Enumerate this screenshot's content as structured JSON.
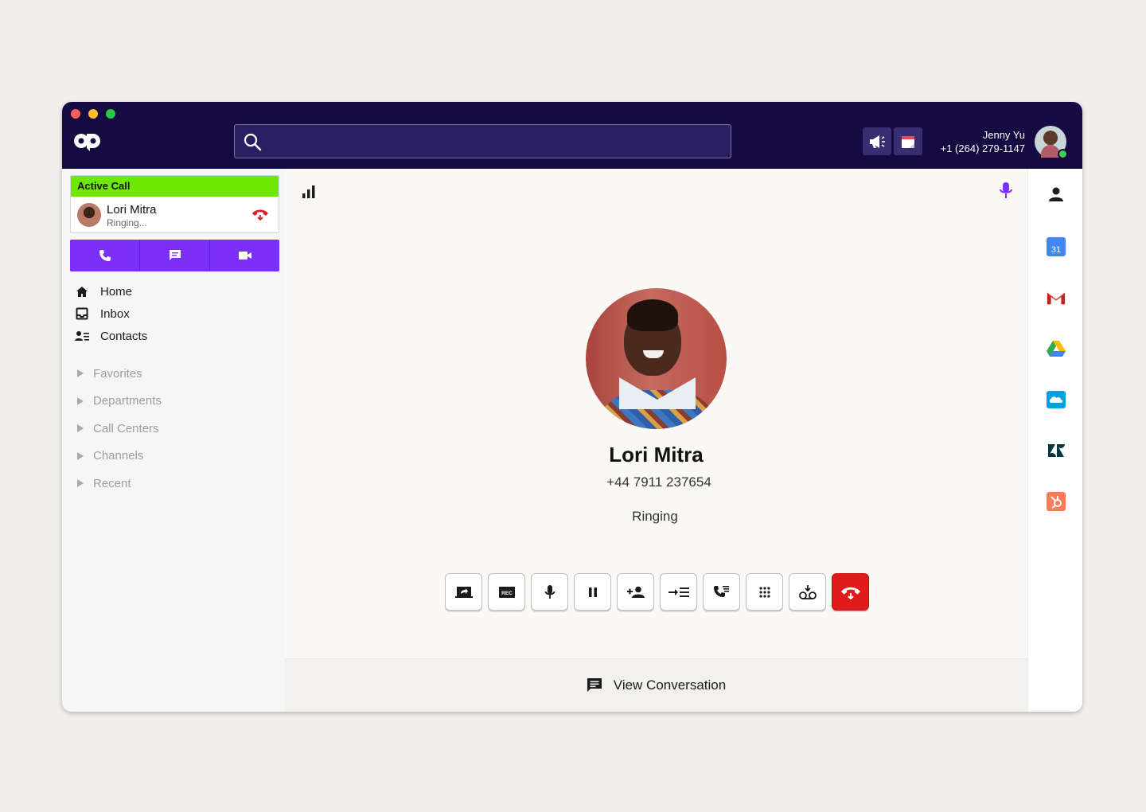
{
  "window": {
    "traffic_lights": [
      "close",
      "minimize",
      "maximize"
    ]
  },
  "topbar": {
    "logo_icon": "dialpad-logo-icon",
    "search": {
      "placeholder": "",
      "value": "",
      "icon": "search-icon"
    },
    "buttons": [
      {
        "icon": "megaphone-icon"
      },
      {
        "icon": "calendar-icon"
      }
    ],
    "user": {
      "name": "Jenny Yu",
      "phone": "+1 (264) 279-1147",
      "presence_color": "#3fd14a"
    }
  },
  "sidebar": {
    "active_call": {
      "header": "Active Call",
      "name": "Lori Mitra",
      "status": "Ringing...",
      "header_color": "#6ee803"
    },
    "quick_actions": [
      {
        "icon": "phone-icon"
      },
      {
        "icon": "message-icon"
      },
      {
        "icon": "video-icon"
      }
    ],
    "nav": [
      {
        "label": "Home",
        "icon": "home-icon"
      },
      {
        "label": "Inbox",
        "icon": "inbox-icon"
      },
      {
        "label": "Contacts",
        "icon": "contacts-icon"
      }
    ],
    "groups": [
      {
        "label": "Favorites"
      },
      {
        "label": "Departments"
      },
      {
        "label": "Call Centers"
      },
      {
        "label": "Channels"
      },
      {
        "label": "Recent"
      }
    ]
  },
  "main": {
    "contact": {
      "name": "Lori Mitra",
      "phone": "+44 7911 237654",
      "status": "Ringing"
    },
    "controls": [
      {
        "name": "share-screen-button",
        "icon": "share-screen-icon"
      },
      {
        "name": "record-button",
        "icon": "rec-icon",
        "text": "REC"
      },
      {
        "name": "mute-button",
        "icon": "mic-icon"
      },
      {
        "name": "hold-button",
        "icon": "pause-icon"
      },
      {
        "name": "add-caller-button",
        "icon": "add-person-icon"
      },
      {
        "name": "transfer-button",
        "icon": "transfer-icon"
      },
      {
        "name": "call-queue-button",
        "icon": "phone-list-icon"
      },
      {
        "name": "keypad-button",
        "icon": "keypad-icon"
      },
      {
        "name": "voicemail-button",
        "icon": "voicemail-icon"
      },
      {
        "name": "hang-up-button",
        "icon": "hang-up-icon"
      }
    ],
    "view_conversation": "View Conversation",
    "accent_color": "#7b2ff7",
    "hangup_color": "#e01b1b"
  },
  "rail": {
    "apps": [
      {
        "icon": "person-icon"
      },
      {
        "icon": "google-calendar-icon",
        "text": "31"
      },
      {
        "icon": "gmail-icon"
      },
      {
        "icon": "google-drive-icon"
      },
      {
        "icon": "salesforce-icon"
      },
      {
        "icon": "zendesk-icon"
      },
      {
        "icon": "hubspot-icon"
      }
    ]
  }
}
